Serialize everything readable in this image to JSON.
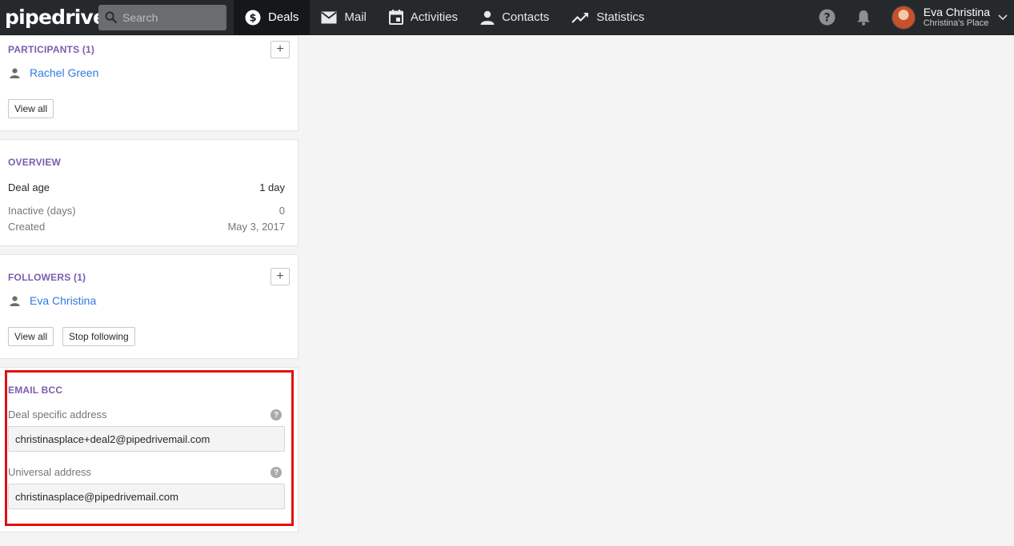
{
  "app": {
    "logo": "pipedrive"
  },
  "search": {
    "placeholder": "Search"
  },
  "nav": {
    "items": [
      {
        "label": "Deals",
        "icon": "dollar-icon",
        "active": true
      },
      {
        "label": "Mail",
        "icon": "mail-icon"
      },
      {
        "label": "Activities",
        "icon": "calendar-icon"
      },
      {
        "label": "Contacts",
        "icon": "person-icon"
      },
      {
        "label": "Statistics",
        "icon": "trend-icon"
      }
    ]
  },
  "user": {
    "name": "Eva Christina",
    "company": "Christina's Place"
  },
  "participants": {
    "title": "PARTICIPANTS (1)",
    "people": [
      "Rachel Green"
    ],
    "view_all": "View all"
  },
  "overview": {
    "title": "OVERVIEW",
    "deal_age_label": "Deal age",
    "deal_age_value": "1 day",
    "inactive_label": "Inactive (days)",
    "inactive_value": "0",
    "created_label": "Created",
    "created_value": "May 3, 2017"
  },
  "followers": {
    "title": "FOLLOWERS (1)",
    "people": [
      "Eva Christina"
    ],
    "view_all": "View all",
    "stop_following": "Stop following"
  },
  "email_bcc": {
    "title": "EMAIL BCC",
    "deal_label": "Deal specific address",
    "deal_value": "christinasplace+deal2@pipedrivemail.com",
    "universal_label": "Universal address",
    "universal_value": "christinasplace@pipedrivemail.com"
  },
  "colors": {
    "accent": "#317ae2",
    "section_title": "#7d5cae",
    "highlight": "#e01010",
    "topbar": "#26292c"
  }
}
